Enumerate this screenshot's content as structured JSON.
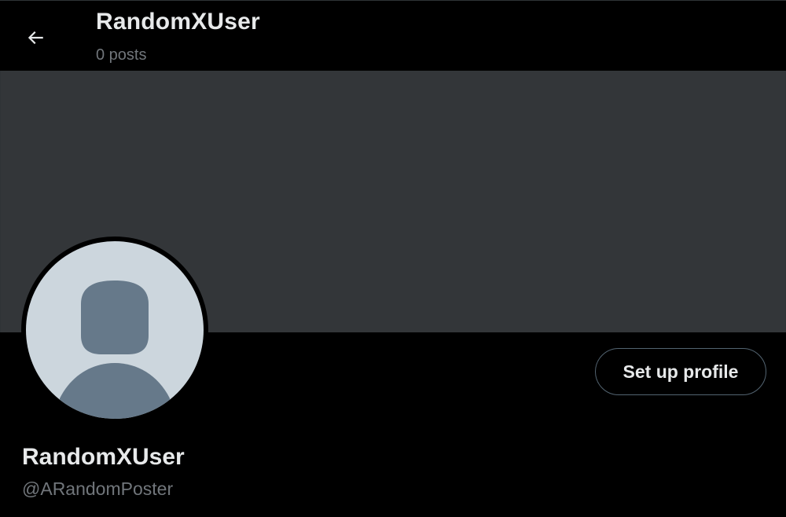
{
  "header": {
    "title": "RandomXUser",
    "post_count": "0 posts",
    "back_icon": "arrow-left-icon"
  },
  "banner": {
    "color": "#333639"
  },
  "avatar": {
    "icon": "default-user-avatar-icon",
    "background": "#ccd6dd",
    "figure_color": "#66798a"
  },
  "actions": {
    "setup_profile_label": "Set up profile"
  },
  "profile": {
    "display_name": "RandomXUser",
    "handle": "@ARandomPoster"
  },
  "colors": {
    "background": "#000000",
    "text_primary": "#e7e9ea",
    "text_secondary": "#71767b",
    "button_border": "#536471"
  }
}
